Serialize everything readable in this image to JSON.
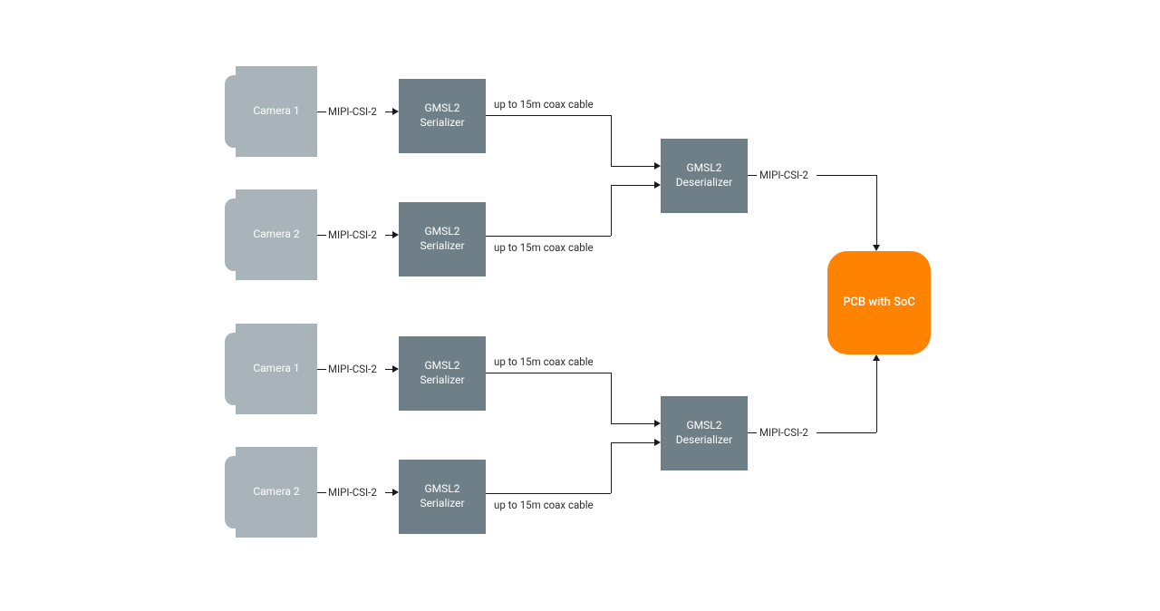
{
  "nodes": {
    "camera_a1": "Camera 1",
    "camera_a2": "Camera 2",
    "camera_b1": "Camera 1",
    "camera_b2": "Camera 2",
    "serializer_a1": "GMSL2\nSerializer",
    "serializer_a2": "GMSL2\nSerializer",
    "serializer_b1": "GMSL2\nSerializer",
    "serializer_b2": "GMSL2\nSerializer",
    "deserializer_a": "GMSL2\nDeserializer",
    "deserializer_b": "GMSL2\nDeserializer",
    "soc": "PCB with SoC"
  },
  "labels": {
    "cam_to_ser_a1": "MIPI-CSI-2",
    "cam_to_ser_a2": "MIPI-CSI-2",
    "cam_to_ser_b1": "MIPI-CSI-2",
    "cam_to_ser_b2": "MIPI-CSI-2",
    "ser_to_deser_a1": "up to 15m coax cable",
    "ser_to_deser_a2": "up to 15m coax cable",
    "ser_to_deser_b1": "up to 15m coax cable",
    "ser_to_deser_b2": "up to 15m coax cable",
    "deser_to_soc_a": "MIPI-CSI-2",
    "deser_to_soc_b": "MIPI-CSI-2"
  },
  "colors": {
    "camera_fill": "#a9b4ba",
    "block_fill": "#6e7f87",
    "soc_fill": "#ff8200",
    "line": "#1a1a1a",
    "label": "#2d2d2d",
    "node_text": "#ffffff"
  }
}
